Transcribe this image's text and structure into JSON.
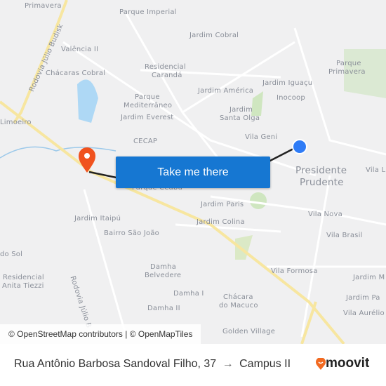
{
  "map": {
    "labels": [
      "Primavera",
      "Parque Imperial",
      "Jardim Cobral",
      "Valência II",
      "Chácaras Cobral",
      "Residencial",
      "Carandá",
      "Parque",
      "Mediterrâneo",
      "Jardim Everest",
      "Jardim América",
      "Jardim Iguaçu",
      "Inocoop",
      "Jardim",
      "Santa Olga",
      "Parque",
      "Primavera",
      "Vila Geni",
      "CECAP",
      "Limoeiro",
      "Jardim Paris",
      "Jardim Colina",
      "Vila Nova",
      "Vila Brasil",
      "Jardim Itaipú",
      "Bairro São João",
      "Damha",
      "Belvedere",
      "Damha I",
      "Damha II",
      "Chácara",
      "do Macuco",
      "Vila Formosa",
      "Golden Village",
      "Residencial",
      "Anita Tiezzi",
      "do Sol",
      "Jardim M",
      "Jardim Pa",
      "Vila Aurélio",
      "Vila L",
      "Parque Ceabu"
    ],
    "city_label_1": "Presidente",
    "city_label_2": "Prudente",
    "road_1": "Rodovia Júlio Budisk",
    "road_2": "Rodovia Júlio B",
    "cta_button": "Take me there",
    "attribution": "© OpenStreetMap contributors | © OpenMapTiles",
    "origin_color": "#2f7cf6",
    "destination_color": "#f0521e"
  },
  "footer": {
    "origin": "Rua Antônio Barbosa Sandoval Filho, 37",
    "arrow": "→",
    "destination": "Campus II",
    "brand": "moovit",
    "brand_color": "#f26a21"
  }
}
